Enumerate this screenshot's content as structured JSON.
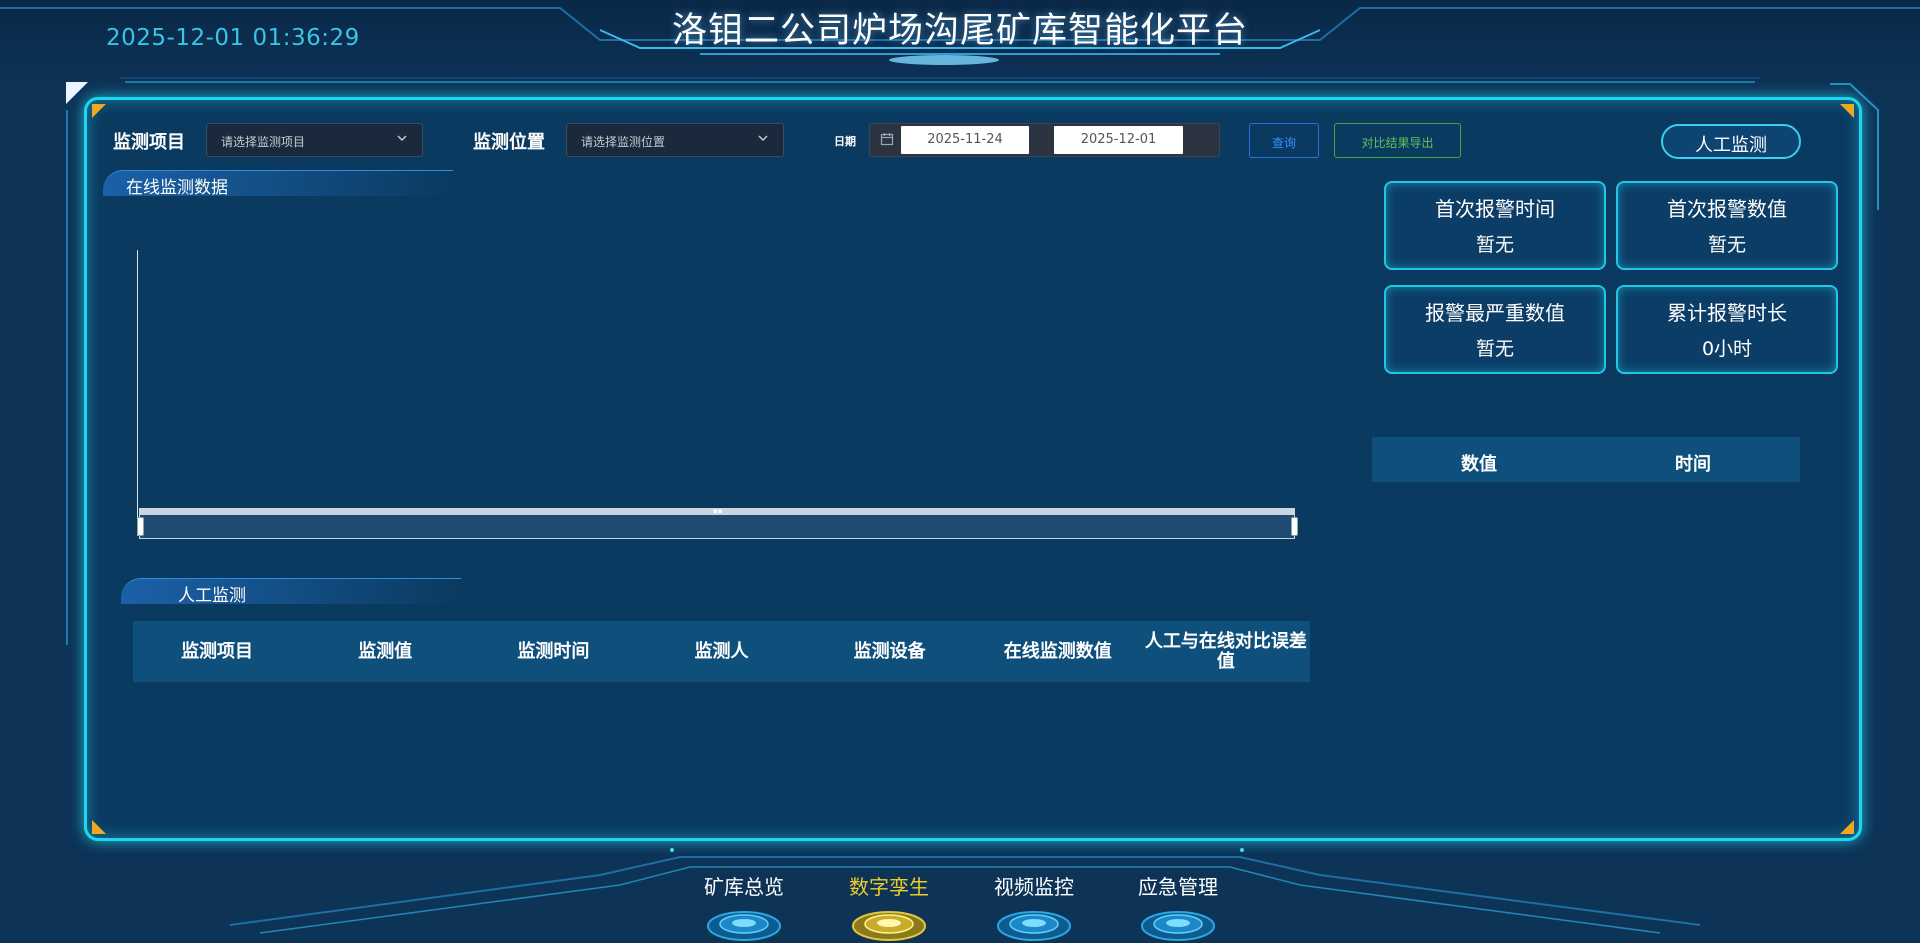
{
  "header": {
    "datetime": "2025-12-01 01:36:29",
    "title": "洛钼二公司炉场沟尾矿库智能化平台"
  },
  "filters": {
    "item_label": "监测项目",
    "item_placeholder": "请选择监测项目",
    "position_label": "监测位置",
    "position_placeholder": "请选择监测位置",
    "date_label": "日期",
    "date_start": "2025-11-24",
    "date_end": "2025-12-01",
    "query_button": "查询",
    "export_button": "对比结果导出",
    "manual_button": "人工监测"
  },
  "sections": {
    "online_title": "在线监测数据",
    "manual_title": "人工监测"
  },
  "stats": [
    {
      "title": "首次报警时间",
      "value": "暂无"
    },
    {
      "title": "首次报警数值",
      "value": "暂无"
    },
    {
      "title": "报警最严重数值",
      "value": "暂无"
    },
    {
      "title": "累计报警时长",
      "value": "0小时"
    }
  ],
  "right_table": {
    "columns": [
      "数值",
      "时间"
    ]
  },
  "manual_table": {
    "columns": [
      "监测项目",
      "监测值",
      "监测时间",
      "监测人",
      "监测设备",
      "在线监测数值",
      "人工与在线对比误差值"
    ]
  },
  "nav": {
    "items": [
      {
        "label": "矿库总览",
        "active": false
      },
      {
        "label": "数字孪生",
        "active": true
      },
      {
        "label": "视频监控",
        "active": false
      },
      {
        "label": "应急管理",
        "active": false
      }
    ]
  },
  "colors": {
    "accent": "#1fd6ef",
    "active_nav": "#f0cc28",
    "datetime": "#36c6e8",
    "corner": "#f1a821"
  },
  "icons": {
    "date": "calendar-icon",
    "select": "chevron-down-icon"
  }
}
